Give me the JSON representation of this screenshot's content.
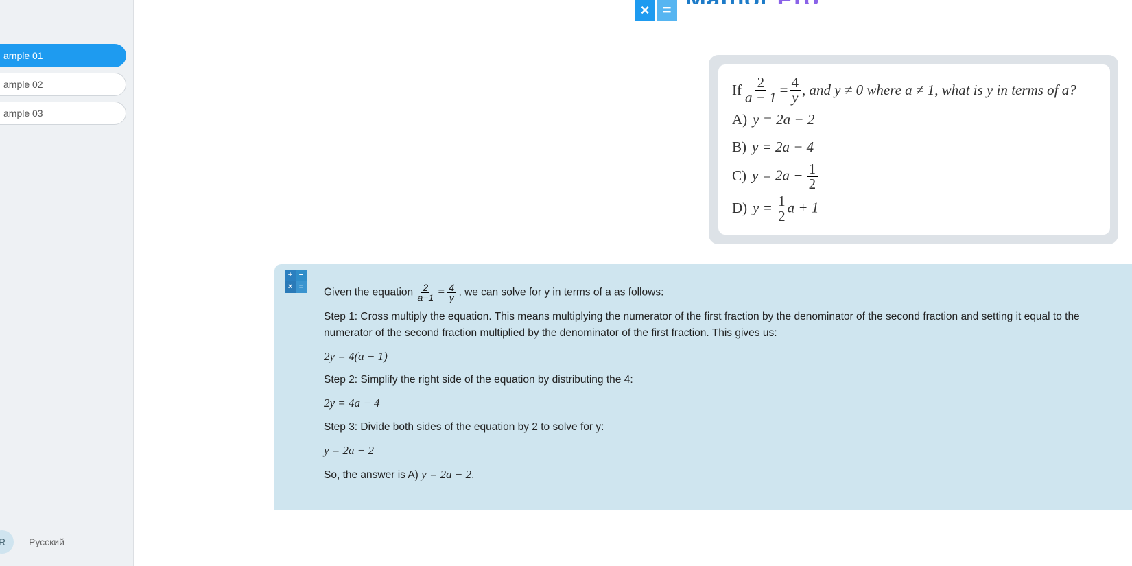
{
  "sidebar": {
    "items": [
      "ample 01",
      "ample 02",
      "ample 03"
    ],
    "lang_badge": "R",
    "lang_label": "Русский"
  },
  "brand": {
    "part1": "Mathor ",
    "part2": "Pro"
  },
  "tiles": {
    "a": "×",
    "b": "="
  },
  "question": {
    "prefix": "If",
    "frac1_num": "2",
    "frac1_den": "a − 1",
    "eq": " = ",
    "frac2_num": "4",
    "frac2_den": "y",
    "cond_text": ", and y ≠ 0 where a ≠ 1, what is y in terms of a?",
    "opts": {
      "A": {
        "label": "A)",
        "expr": "y = 2a − 2"
      },
      "B": {
        "label": "B)",
        "expr": "y = 2a − 4"
      },
      "C": {
        "label": "C)",
        "pre": "y = 2a − ",
        "f_num": "1",
        "f_den": "2"
      },
      "D": {
        "label": "D)",
        "pre": "y = ",
        "f_num": "1",
        "f_den": "2",
        "post": "a + 1"
      }
    }
  },
  "answer": {
    "intro_a": "Given the equation ",
    "intro_b": ", we can solve for y in terms of a as follows:",
    "f1n": "2",
    "f1d": "a−1",
    "eq": " = ",
    "f2n": "4",
    "f2d": "y",
    "s1": "Step 1: Cross multiply the equation. This means multiplying the numerator of the first fraction by the denominator of the second fraction and setting it equal to the numerator of the second fraction multiplied by the denominator of the first fraction. This gives us:",
    "m1": "2y = 4(a − 1)",
    "s2": "Step 2: Simplify the right side of the equation by distributing the 4:",
    "m2": "2y = 4a − 4",
    "s3": "Step 3: Divide both sides of the equation by 2 to solve for y:",
    "m3": "y = 2a − 2",
    "s4": "So, the answer is A) y = 2a − 2."
  }
}
